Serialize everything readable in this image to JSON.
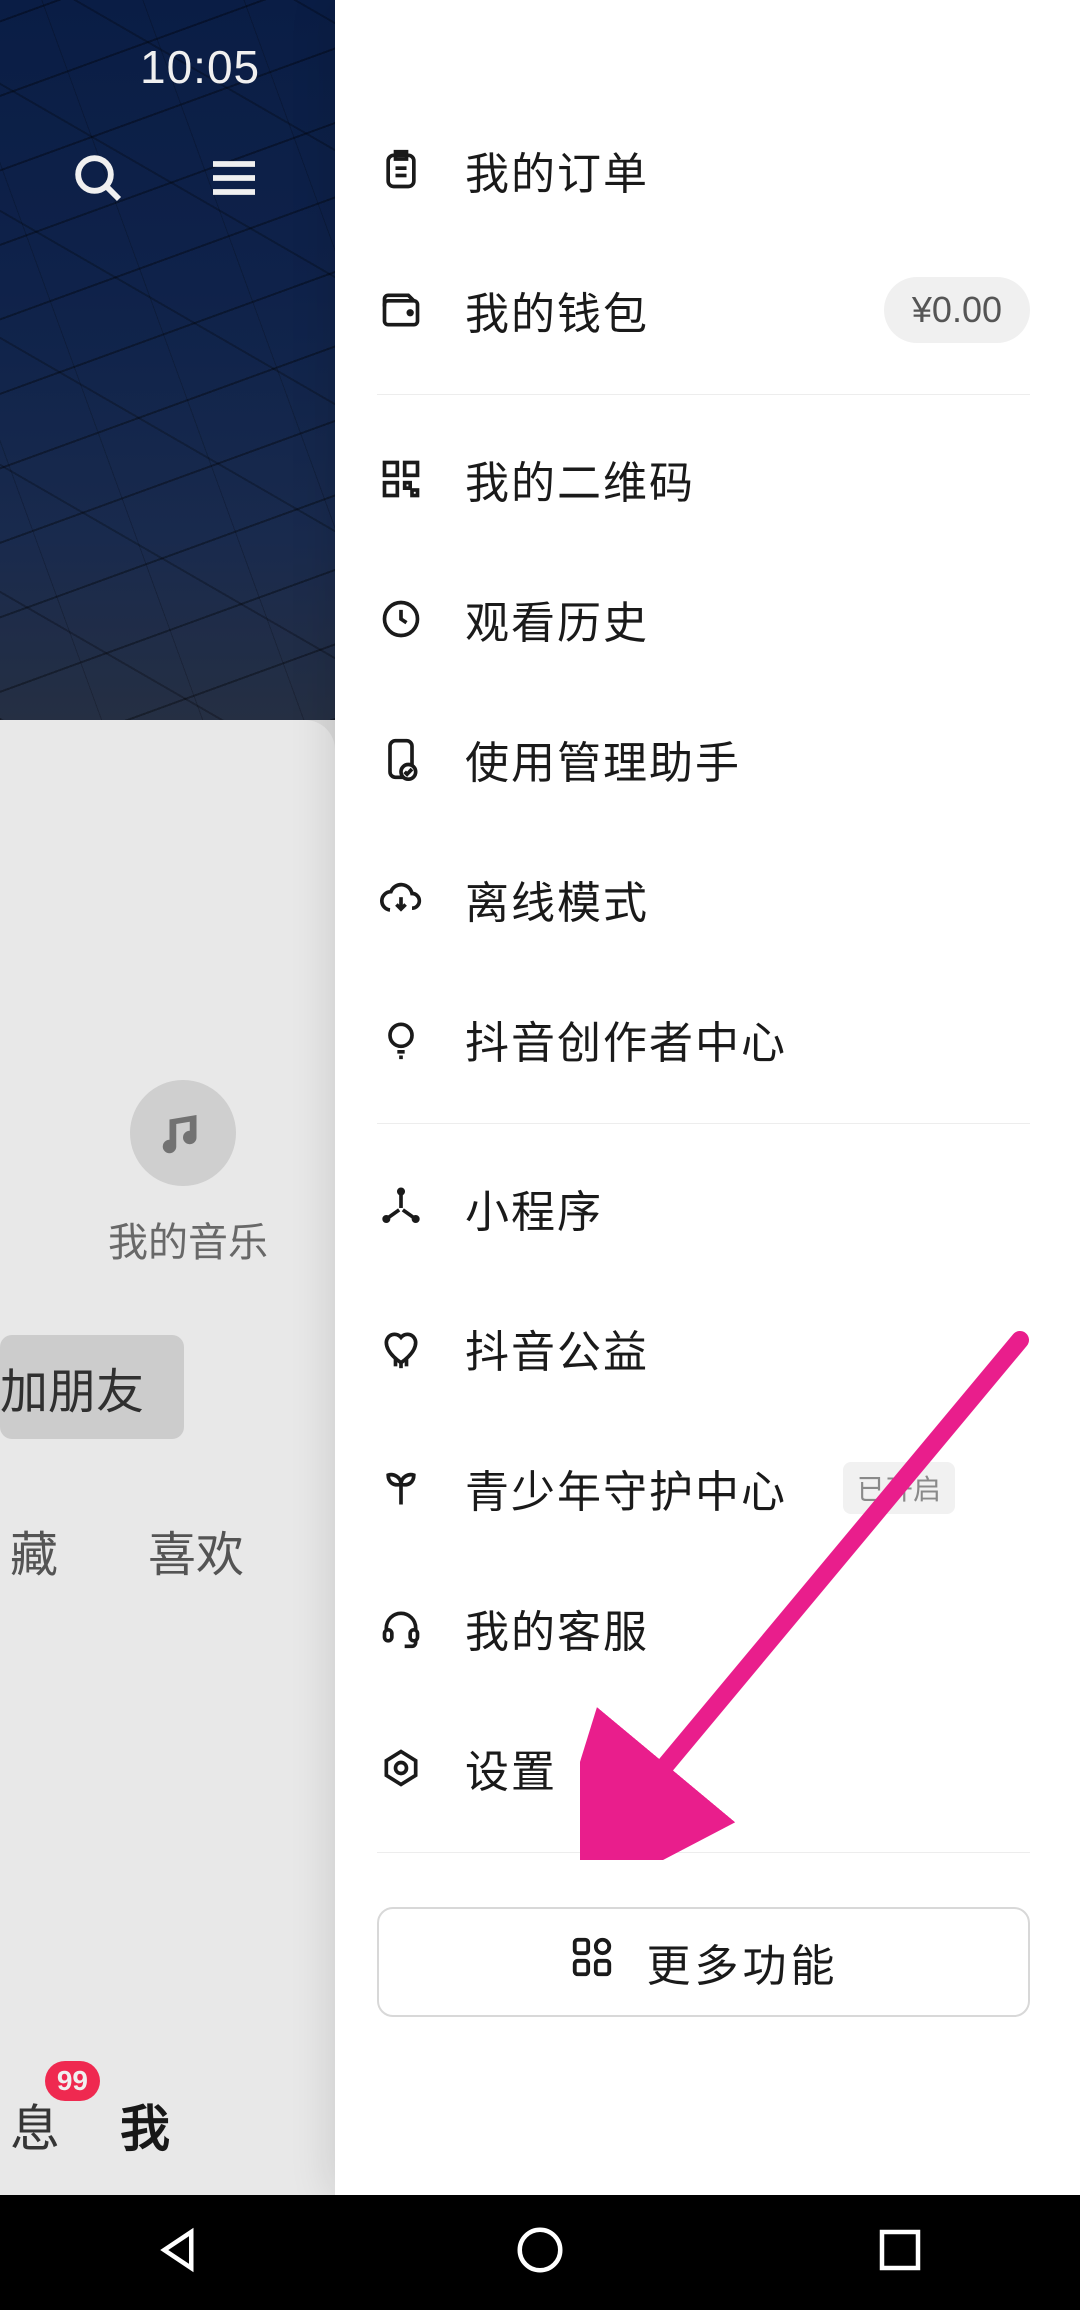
{
  "status_bar": {
    "time": "10:05"
  },
  "background": {
    "music_label": "我的音乐",
    "add_friend_button": "加朋友",
    "tabs": {
      "favorites": "藏",
      "likes": "喜欢"
    },
    "bottom_nav": {
      "messages_label": "息",
      "messages_badge": "99",
      "me_label": "我"
    }
  },
  "drawer": {
    "items": [
      {
        "label": "我的订单"
      },
      {
        "label": "我的钱包",
        "right_pill": "¥0.00"
      },
      {
        "label": "我的二维码"
      },
      {
        "label": "观看历史"
      },
      {
        "label": "使用管理助手"
      },
      {
        "label": "离线模式"
      },
      {
        "label": "抖音创作者中心"
      },
      {
        "label": "小程序"
      },
      {
        "label": "抖音公益"
      },
      {
        "label": "青少年守护中心",
        "tag": "已开启"
      },
      {
        "label": "我的客服"
      },
      {
        "label": "设置"
      }
    ],
    "more_button": "更多功能"
  }
}
